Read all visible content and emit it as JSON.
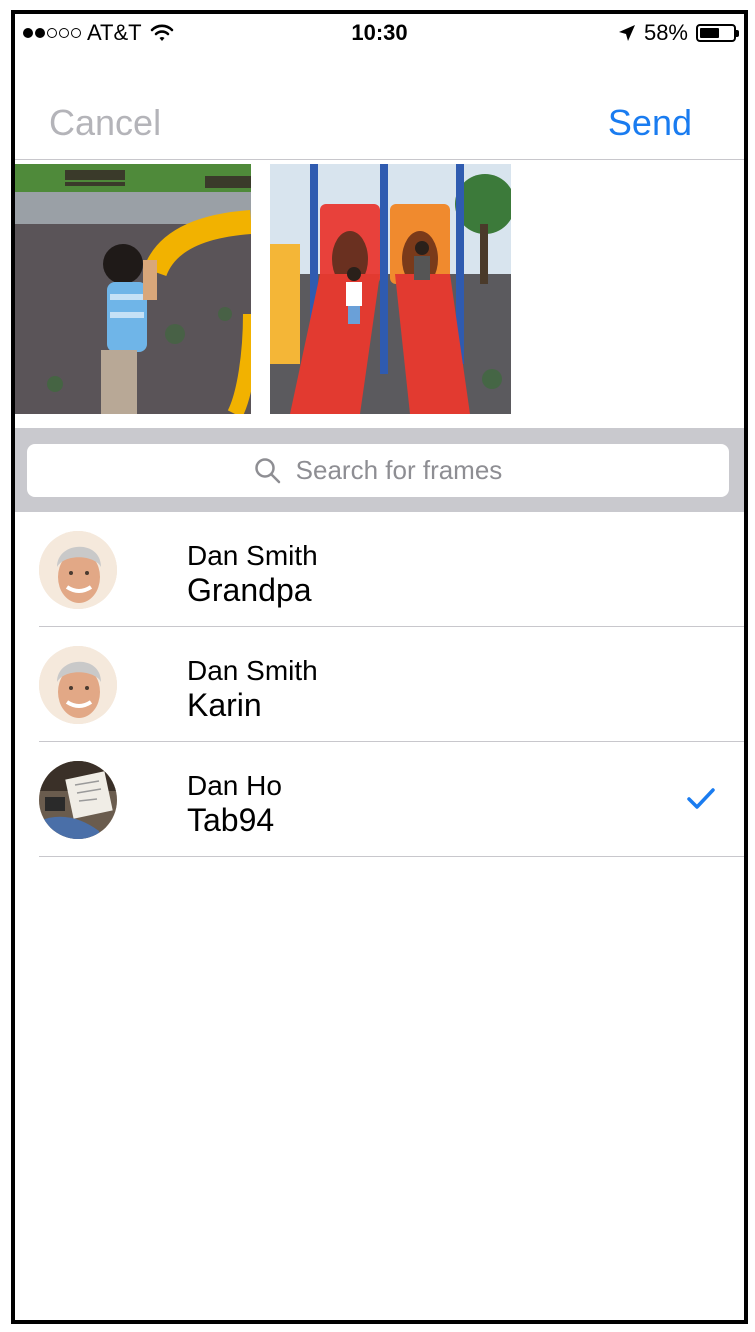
{
  "status_bar": {
    "carrier": "AT&T",
    "time": "10:30",
    "battery_percent": "58%",
    "battery_level": 0.58,
    "signal_bars_filled": 2,
    "signal_bars_total": 5
  },
  "nav": {
    "cancel_label": "Cancel",
    "send_label": "Send",
    "accent_color": "#1a7cf0",
    "disabled_color": "#b4b4b9"
  },
  "photos": [
    {
      "name": "child-on-playground-bar-photo"
    },
    {
      "name": "children-on-red-slides-photo"
    }
  ],
  "search": {
    "placeholder": "Search for frames",
    "icon": "search-icon"
  },
  "contacts": [
    {
      "name": "Dan Smith",
      "frame": "Grandpa",
      "avatar": "man-portrait",
      "selected": false
    },
    {
      "name": "Dan Smith",
      "frame": "Karin",
      "avatar": "man-portrait",
      "selected": false
    },
    {
      "name": "Dan Ho",
      "frame": "Tab94",
      "avatar": "drawing-photo",
      "selected": true
    }
  ]
}
